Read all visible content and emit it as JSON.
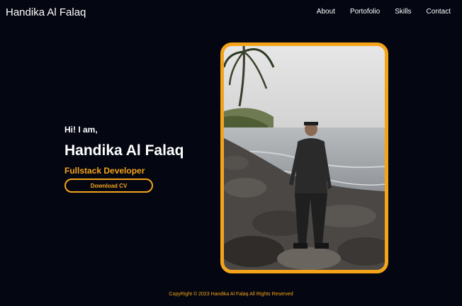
{
  "navbar": {
    "brand": "Handika Al Falaq",
    "links": [
      "About",
      "Portofolio",
      "Skills",
      "Contact"
    ]
  },
  "hero": {
    "greeting": "Hi! I am,",
    "name": "Handika Al Falaq",
    "role": "Fullstack Developer",
    "cta_label": "Download CV"
  },
  "footer": {
    "text": "CopyRight © 2023 Handika Al Falaq All Rights Reserved"
  },
  "colors": {
    "background": "#040611",
    "accent": "#f5a419",
    "text": "#ffffff"
  }
}
